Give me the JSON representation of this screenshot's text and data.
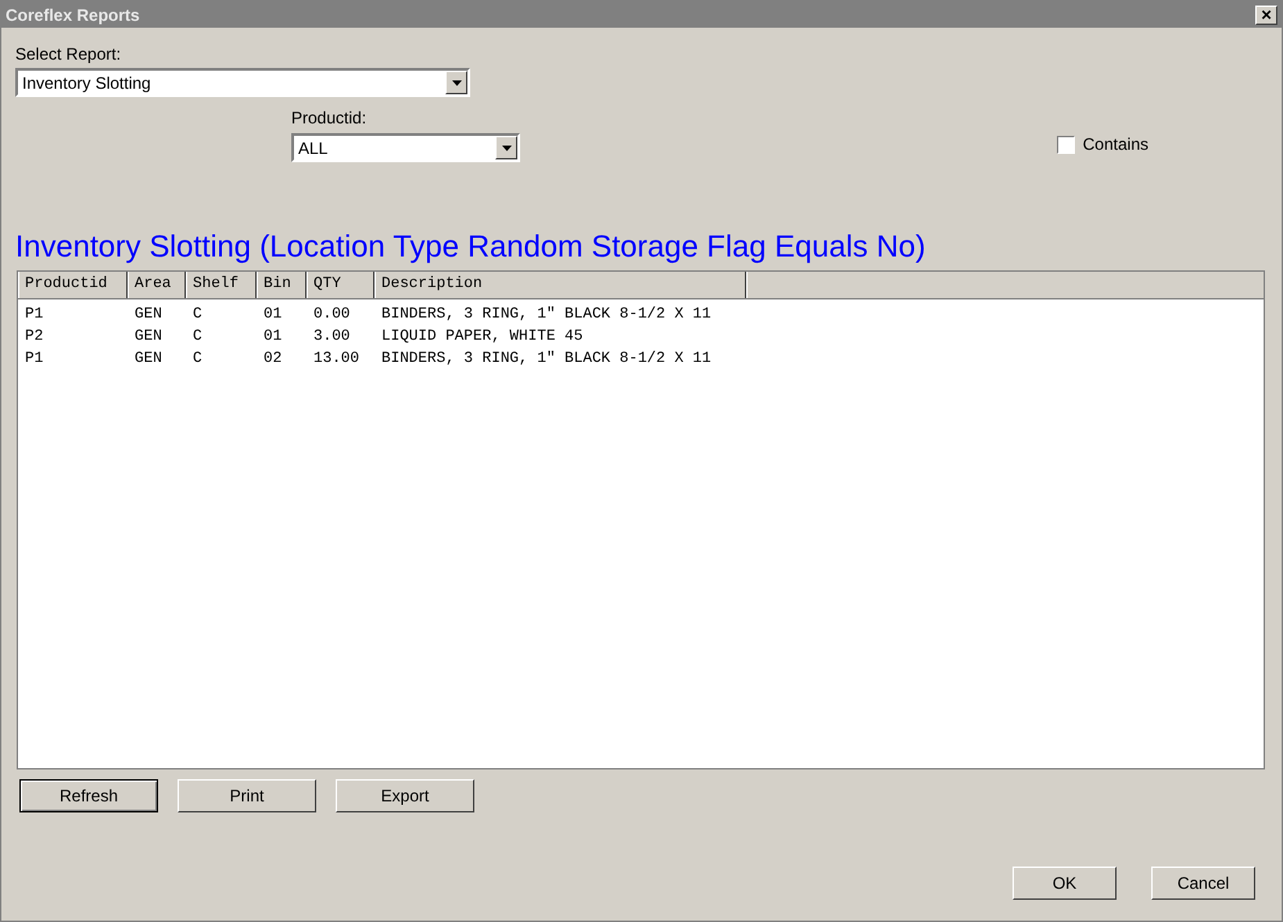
{
  "window": {
    "title": "Coreflex Reports",
    "close": "×"
  },
  "report_select": {
    "label": "Select Report:",
    "value": "Inventory Slotting"
  },
  "productid_select": {
    "label": "Productid:",
    "value": "ALL"
  },
  "contains": {
    "label": "Contains",
    "checked": false
  },
  "heading": "Inventory Slotting (Location Type Random Storage Flag Equals No)",
  "table": {
    "columns": [
      "Productid",
      "Area",
      "Shelf",
      "Bin",
      "QTY",
      "Description"
    ],
    "rows": [
      [
        "P1",
        "GEN",
        "C",
        "01",
        "0.00",
        "BINDERS, 3 RING, 1\" BLACK 8-1/2 X 11"
      ],
      [
        "P2",
        "GEN",
        "C",
        "01",
        "3.00",
        "LIQUID PAPER, WHITE 45"
      ],
      [
        "P1",
        "GEN",
        "C",
        "02",
        "13.00",
        "BINDERS, 3 RING, 1\" BLACK 8-1/2 X 11"
      ]
    ]
  },
  "actions": [
    {
      "label": "Refresh",
      "default": true
    },
    {
      "label": "Print",
      "default": false
    },
    {
      "label": "Export",
      "default": false
    }
  ],
  "dialog_buttons": [
    {
      "label": "OK",
      "default": false
    },
    {
      "label": "Cancel",
      "default": false
    }
  ]
}
